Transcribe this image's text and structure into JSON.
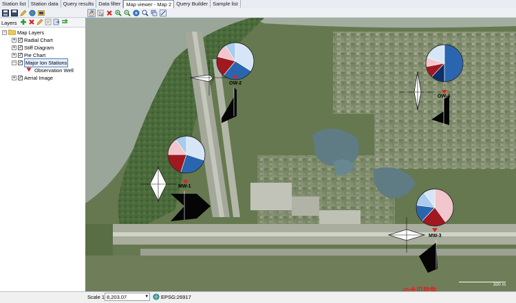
{
  "tabs": [
    {
      "label": "Station list"
    },
    {
      "label": "Station data"
    },
    {
      "label": "Query results"
    },
    {
      "label": "Data filter"
    },
    {
      "label": "Map viewer - Map 2",
      "active": true
    },
    {
      "label": "Query Builder"
    },
    {
      "label": "Sample list"
    }
  ],
  "layers": {
    "title": "Layers",
    "root": "Map Layers",
    "items": [
      {
        "label": "Radial Chart",
        "checked": true
      },
      {
        "label": "Stiff Diagram",
        "checked": true
      },
      {
        "label": "Pie Chart",
        "checked": true
      },
      {
        "label": "Major Ion Stations",
        "checked": true,
        "selected": true
      },
      {
        "label": "Observation Well",
        "symbol": "red-triangle"
      },
      {
        "label": "Aerial Image",
        "checked": true
      }
    ]
  },
  "stations": [
    {
      "label": "OW-2"
    },
    {
      "label": "OW-4"
    },
    {
      "label": "MW-1"
    },
    {
      "label": "MW-3"
    }
  ],
  "status": {
    "scale_label": "Scale 1:",
    "scale_value": "8,203.07",
    "crs": "EPSG:26917"
  },
  "map": {
    "scalebar_label": "300 m",
    "watermark": "@卡贝软件"
  },
  "colors": {
    "marker": "#d92626",
    "pie_light": "#d7e6f6",
    "pie_mid": "#2a66b0",
    "pie_dark": "#0f2f6a",
    "pie_red": "#a01820",
    "pie_pink": "#f1c6cc",
    "pie_lightblue": "#a9ccec"
  }
}
